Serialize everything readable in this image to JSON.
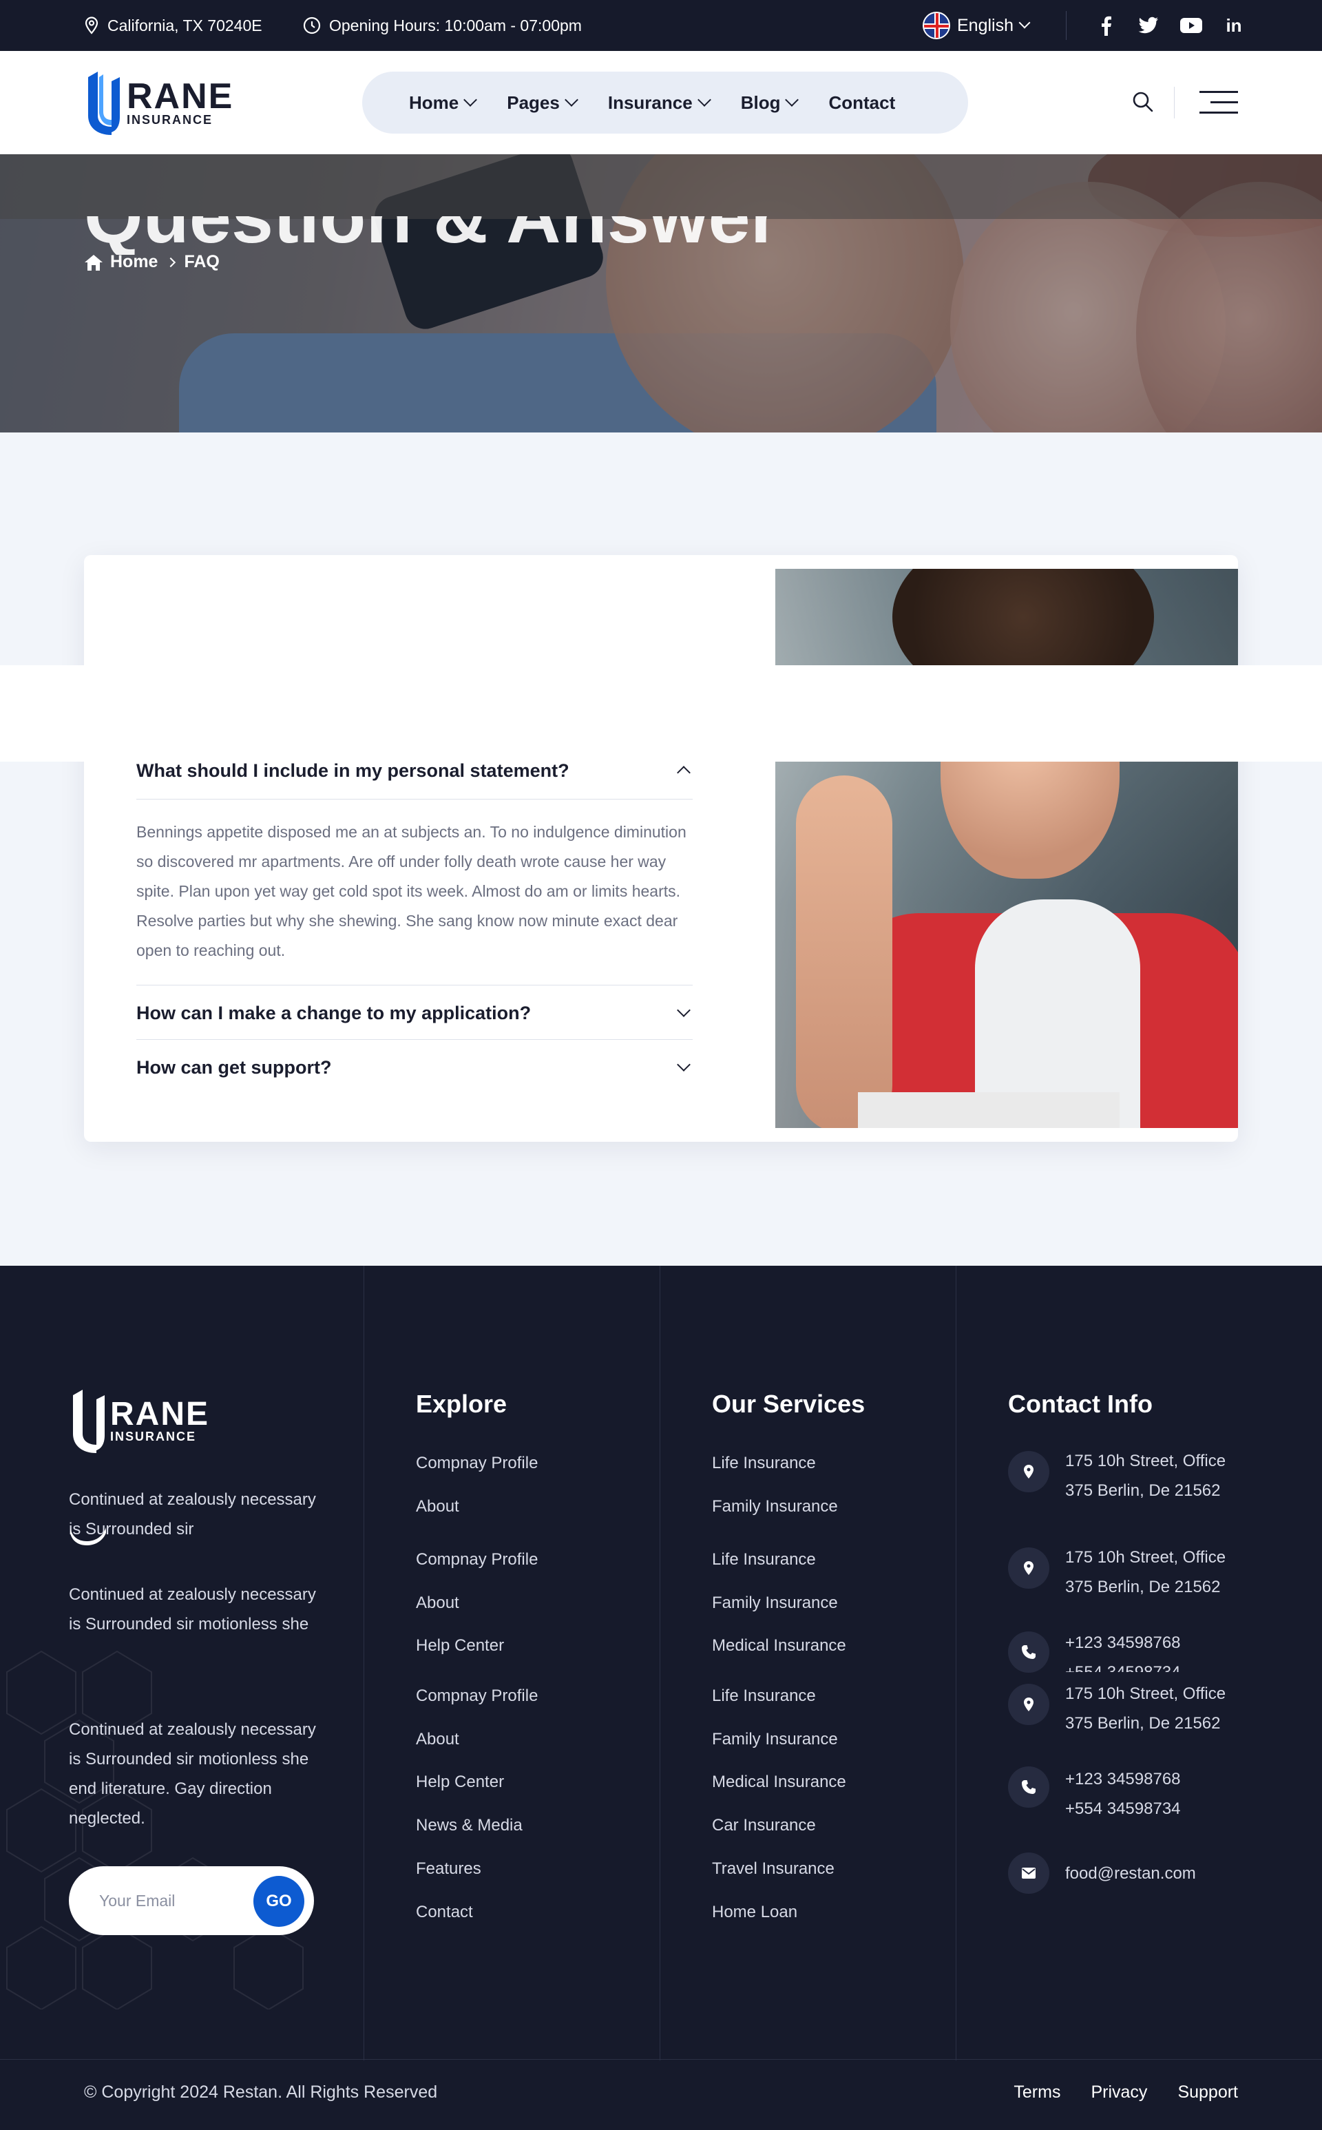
{
  "topbar": {
    "address": "California, TX 70240E",
    "hours": "Opening Hours: 10:00am - 07:00pm",
    "language": "English",
    "socials": [
      "facebook-icon",
      "twitter-icon",
      "youtube-icon",
      "linkedin-icon"
    ]
  },
  "header": {
    "logo_big": "RANE",
    "logo_small": "INSURANCE",
    "nav": [
      {
        "label": "Home",
        "dropdown": true
      },
      {
        "label": "Pages",
        "dropdown": true
      },
      {
        "label": "Insurance",
        "dropdown": true
      },
      {
        "label": "Blog",
        "dropdown": true
      },
      {
        "label": "Contact",
        "dropdown": false
      }
    ]
  },
  "banner": {
    "title": "Question & Answer",
    "breadcrumb_home": "Home",
    "breadcrumb_current": "FAQ"
  },
  "faq": {
    "items": [
      {
        "question": "What should I include in my personal statement?",
        "answer": "Bennings appetite disposed me an at subjects an. To no indulgence diminution so discovered mr apartments. Are off under folly death wrote cause her way spite. Plan upon yet way get cold spot its week. Almost do am or limits hearts. Resolve parties but why she shewing. She sang know now minute exact dear open to reaching out.",
        "expanded": true
      },
      {
        "question": "How can I make a change to my application?",
        "expanded": false
      },
      {
        "question": "How can get support?",
        "expanded": false
      }
    ]
  },
  "footer": {
    "logo_big": "RANE",
    "logo_small": "INSURANCE",
    "about_1": "Continued at zealously necessary is Surrounded sir",
    "about_2": "Continued at zealously necessary is Surrounded sir motionless she end literature. Gay direction neglected.",
    "about_3": "Continued at zealously necessary is Surrounded sir motionless she end literature. Gay direction neglected.",
    "email_placeholder": "Your Email",
    "go_label": "GO",
    "explore_title": "Explore",
    "explore_a": [
      "Compnay Profile",
      "About"
    ],
    "explore_b": [
      "Compnay Profile",
      "About",
      "Help Center"
    ],
    "explore_c": [
      "Compnay Profile",
      "About",
      "Help Center",
      "News & Media",
      "Features",
      "Contact"
    ],
    "services_title": "Our Services",
    "services_a": [
      "Life Insurance",
      "Family Insurance"
    ],
    "services_b": [
      "Life Insurance",
      "Family Insurance",
      "Medical Insurance"
    ],
    "services_c": [
      "Life Insurance",
      "Family Insurance",
      "Medical Insurance",
      "Car Insurance",
      "Travel Insurance",
      "Home Loan"
    ],
    "contact_title": "Contact Info",
    "address_line1": "175 10h Street, Office",
    "address_line2": "375 Berlin, De 21562",
    "phone1": "+123 34598768",
    "phone2": "+554 34598734",
    "email": "food@restan.com",
    "copyright": "© Copyright 2024 Restan. All Rights Reserved",
    "bottom_links": [
      "Terms",
      "Privacy",
      "Support"
    ]
  },
  "colors": {
    "dark": "#161a2b",
    "accent": "#0d5bd1",
    "nav_bg": "#e8edf6",
    "page_bg": "#f2f5fa"
  }
}
